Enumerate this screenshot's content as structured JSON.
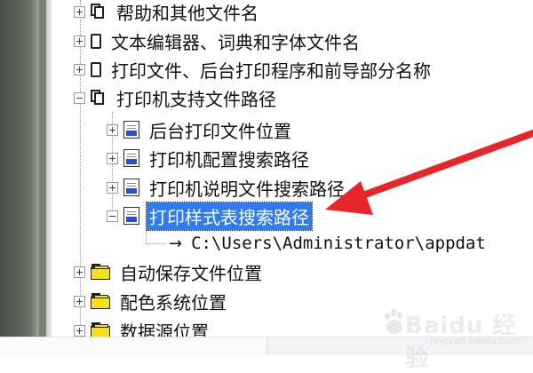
{
  "tree": {
    "items": [
      {
        "label": "帮助和其他文件名",
        "expanded": false,
        "icon": "pages-icon"
      },
      {
        "label": "文本编辑器、词典和字体文件名",
        "expanded": false,
        "icon": "page-icon"
      },
      {
        "label": "打印文件、后台打印程序和前导部分名称",
        "expanded": false,
        "icon": "page-icon"
      },
      {
        "label": "打印机支持文件路径",
        "expanded": true,
        "icon": "pages-icon"
      }
    ],
    "children": [
      {
        "label": "后台打印文件位置",
        "expanded": false,
        "icon": "doc-icon"
      },
      {
        "label": "打印机配置搜索路径",
        "expanded": false,
        "icon": "doc-icon"
      },
      {
        "label": "打印机说明文件搜索路径",
        "expanded": false,
        "icon": "doc-icon"
      },
      {
        "label": "打印样式表搜索路径",
        "expanded": true,
        "selected": true,
        "icon": "doc-icon"
      }
    ],
    "path_value": "C:\\Users\\Administrator\\appdat",
    "path_arrow": "→",
    "lower_items": [
      {
        "label": "自动保存文件位置",
        "expanded": false,
        "icon": "folder-icon"
      },
      {
        "label": "配色系统位置",
        "expanded": false,
        "icon": "folder-icon"
      },
      {
        "label": "数据源位置",
        "expanded": false,
        "icon": "folder-icon"
      }
    ]
  },
  "watermark": {
    "brand": "Baidu 经验",
    "sub": "jingyan.baidu.com"
  },
  "colors": {
    "selection": "#2f7bf2",
    "arrow": "#e8262a",
    "folder": "#f3e21a"
  }
}
